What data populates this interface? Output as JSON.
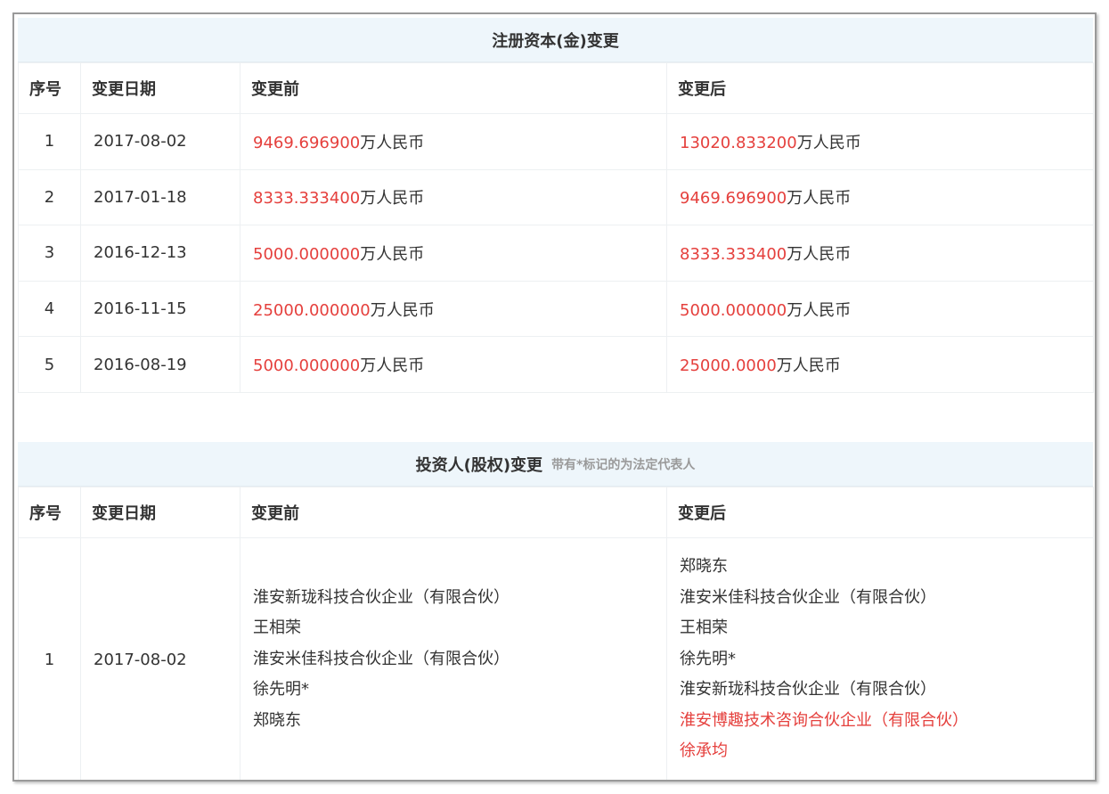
{
  "capital": {
    "title": "注册资本(金)变更",
    "columns": [
      "序号",
      "变更日期",
      "变更前",
      "变更后"
    ],
    "rows": [
      {
        "no": "1",
        "date": "2017-08-02",
        "before_num": "9469.696900",
        "before_unit": "万人民币",
        "after_num": "13020.833200",
        "after_unit": "万人民币"
      },
      {
        "no": "2",
        "date": "2017-01-18",
        "before_num": "8333.333400",
        "before_unit": "万人民币",
        "after_num": "9469.696900",
        "after_unit": "万人民币"
      },
      {
        "no": "3",
        "date": "2016-12-13",
        "before_num": "5000.000000",
        "before_unit": "万人民币",
        "after_num": "8333.333400",
        "after_unit": "万人民币"
      },
      {
        "no": "4",
        "date": "2016-11-15",
        "before_num": "25000.000000",
        "before_unit": "万人民币",
        "after_num": "5000.000000",
        "after_unit": "万人民币"
      },
      {
        "no": "5",
        "date": "2016-08-19",
        "before_num": "5000.000000",
        "before_unit": "万人民币",
        "after_num": "25000.0000",
        "after_unit": "万人民币"
      }
    ]
  },
  "investor": {
    "title": "投资人(股权)变更",
    "note": "带有*标记的为法定代表人",
    "columns": [
      "序号",
      "变更日期",
      "变更前",
      "变更后"
    ],
    "rows": [
      {
        "no": "1",
        "date": "2017-08-02",
        "before": [
          "淮安新珑科技合伙企业（有限合伙）",
          "王相荣",
          "淮安米佳科技合伙企业（有限合伙）",
          "徐先明*",
          "郑晓东"
        ],
        "after": [
          "郑晓东",
          "淮安米佳科技合伙企业（有限合伙）",
          "王相荣",
          "徐先明*",
          "淮安新珑科技合伙企业（有限合伙）",
          "淮安博趣技术咨询合伙企业（有限合伙）",
          "徐承均"
        ],
        "after_highlight_from": 5
      }
    ]
  },
  "colors": {
    "accent_red": "#e5403d",
    "header_bg": "#eef6fb",
    "text": "#333333",
    "note_gray": "#9a9a9a"
  }
}
